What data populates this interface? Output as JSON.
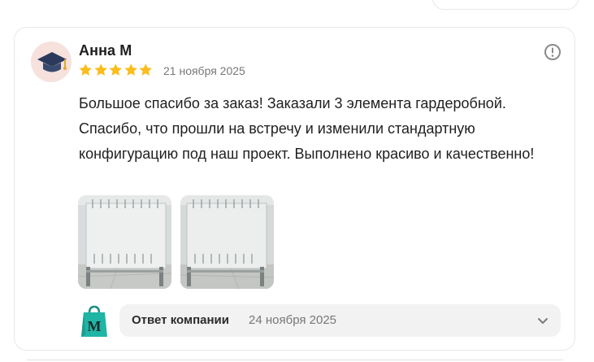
{
  "review": {
    "author": "Анна М",
    "rating": 5,
    "date": "21 ноября 2025",
    "text": "Большое спасибо за заказ! Заказали 3 элемента гардеробной. Спасибо, что прошли на встречу и изменили стандартную конфигурацию под наш проект. Выполнено красиво и качественно!",
    "photos_count": 2
  },
  "reply": {
    "label": "Ответ компании",
    "date": "24 ноября 2025",
    "logo_letter": "M"
  },
  "colors": {
    "star": "#fbbd1d",
    "logo_bag": "#1fb5a5",
    "avatar_bg": "#f6e1dd"
  },
  "icons": {
    "more": "exclamation-circle-icon",
    "expand": "chevron-down-icon",
    "avatar": "graduation-cap-icon"
  }
}
